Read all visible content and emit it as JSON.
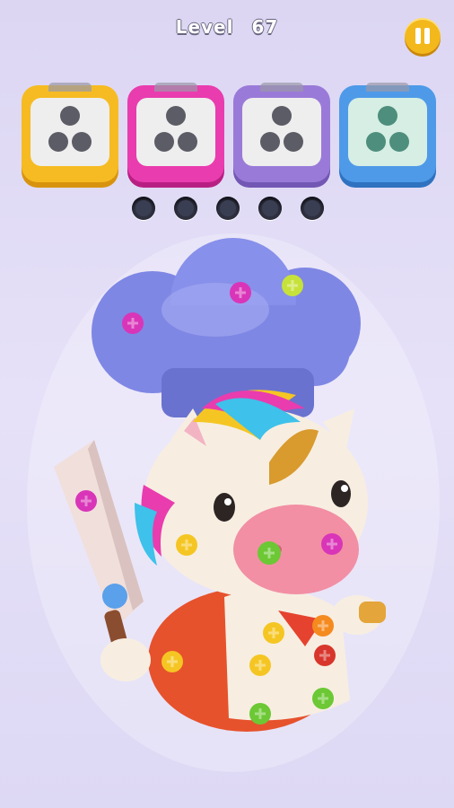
{
  "hud": {
    "level_label": "Level",
    "level_number": "67",
    "pause_icon": "pause-icon"
  },
  "boxes": [
    {
      "name": "yellow",
      "color": "#f6bb22",
      "inner": "#eeeeee",
      "hole": "#5c5c66"
    },
    {
      "name": "pink",
      "color": "#e93cae",
      "inner": "#eeeeee",
      "hole": "#5c5c66"
    },
    {
      "name": "purple",
      "color": "#9a7ad8",
      "inner": "#eeeeee",
      "hole": "#5c5c66"
    },
    {
      "name": "blue",
      "color": "#4e9ae8",
      "inner": "#d6eee4",
      "hole": "#4e8e7c"
    }
  ],
  "holding_slots": [
    {
      "filled": false
    },
    {
      "filled": false
    },
    {
      "filled": false
    },
    {
      "filled": false
    },
    {
      "filled": false
    }
  ],
  "character": "unicorn-chef",
  "screw_colors": {
    "magenta": "#d935b8",
    "yellow": "#f5c623",
    "green": "#6cc834",
    "lime": "#c6e23a",
    "orange": "#f58a1f",
    "red": "#d8362c",
    "blue": "#4a86e2"
  }
}
